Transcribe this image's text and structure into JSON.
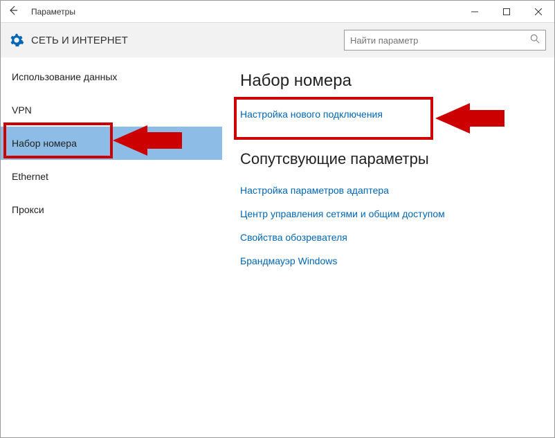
{
  "titlebar": {
    "title": "Параметры"
  },
  "header": {
    "title": "СЕТЬ И ИНТЕРНЕТ",
    "search_placeholder": "Найти параметр"
  },
  "sidebar": {
    "items": [
      {
        "label": "Использование данных"
      },
      {
        "label": "VPN"
      },
      {
        "label": "Набор номера"
      },
      {
        "label": "Ethernet"
      },
      {
        "label": "Прокси"
      }
    ]
  },
  "main": {
    "heading1": "Набор номера",
    "new_connection": "Настройка нового подключения",
    "heading2": "Сопутсвующие параметры",
    "links": [
      "Настройка параметров адаптера",
      "Центр управления сетями и общим доступом",
      "Свойства обозревателя",
      "Брандмауэр Windows"
    ]
  }
}
